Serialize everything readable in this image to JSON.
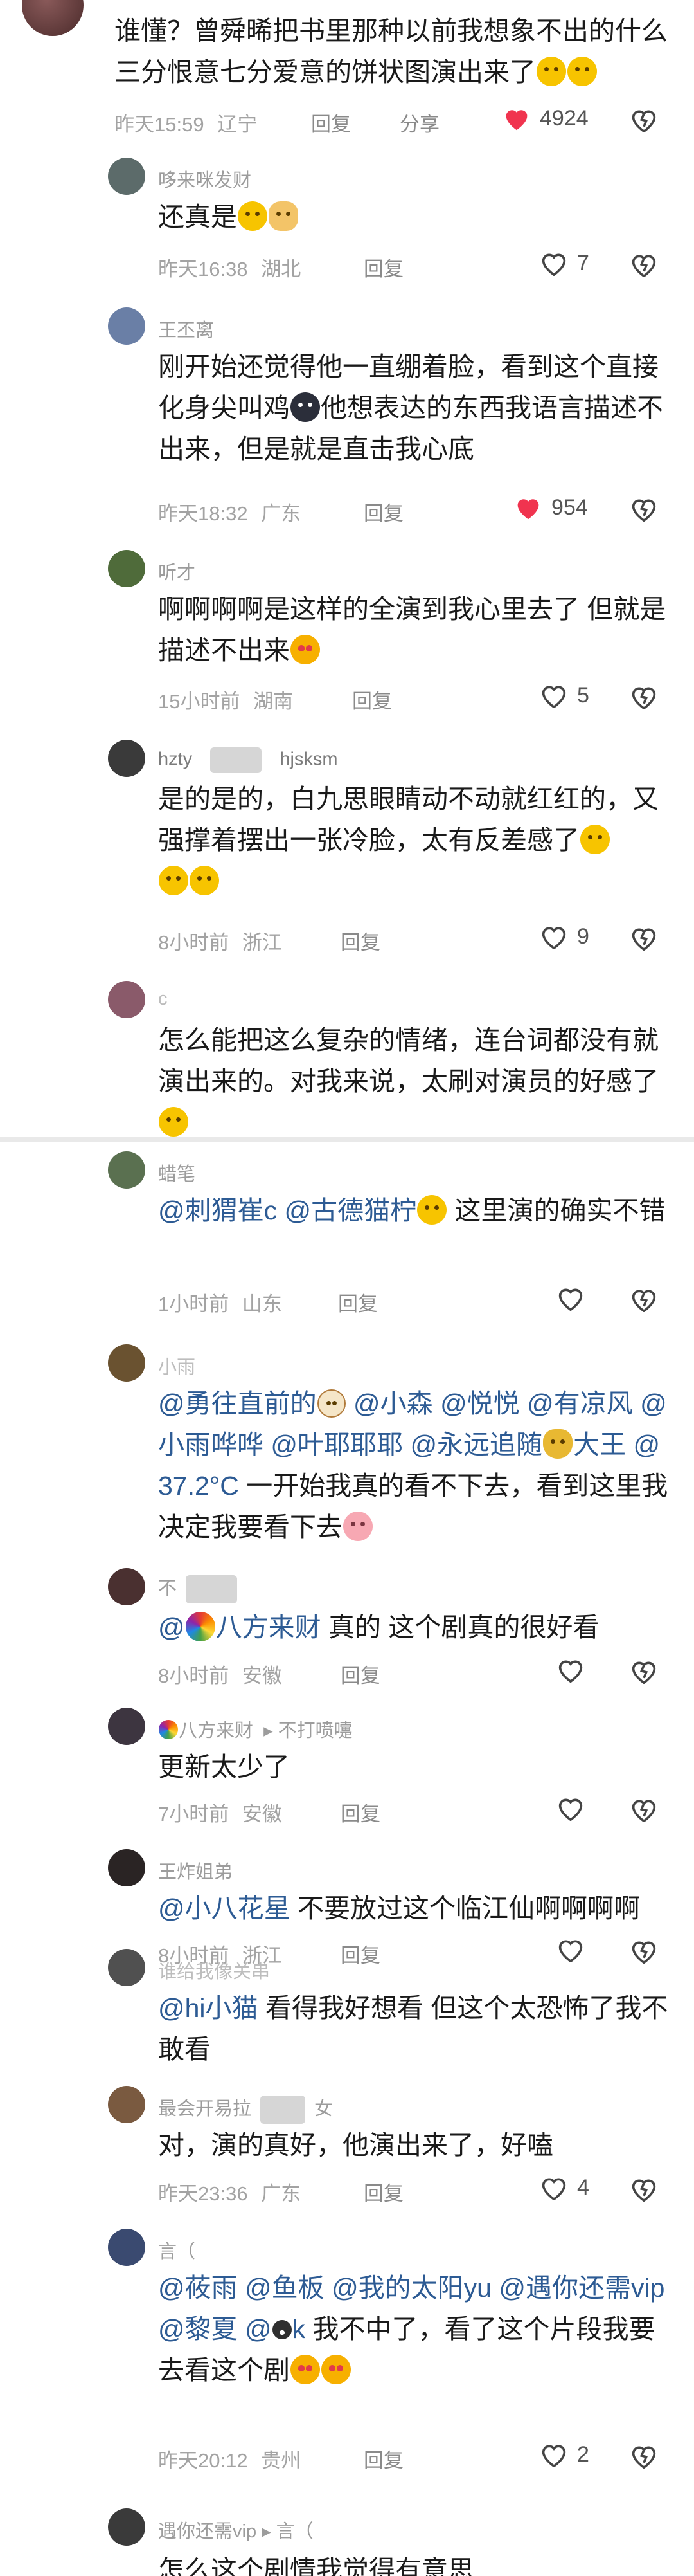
{
  "comments": [
    {
      "text_parts": [
        "谁懂？曾舜晞把书里那种以前我想象不出的什么三分恨意七分爱意的饼状图演出来了"
      ],
      "time": "昨天15:59",
      "location": "辽宁",
      "reply": "回复",
      "share": "分享",
      "likes": "4924"
    },
    {
      "username": "哆来咪发财",
      "text": "还真是",
      "time": "昨天16:38",
      "location": "湖北",
      "reply": "回复",
      "likes": "7"
    },
    {
      "username": "王丕离",
      "text_a": "刚开始还觉得他一直绷着脸，看到这个直接化身尖叫鸡",
      "text_b": "他想表达的东西我语言描述不出来，但是就是直击我心底",
      "time": "昨天18:32",
      "location": "广东",
      "reply": "回复",
      "likes": "954"
    },
    {
      "username": "听才",
      "text": "啊啊啊啊是这样的全演到我心里去了 但就是描述不出来",
      "time": "15小时前",
      "location": "湖南",
      "reply": "回复",
      "likes": "5"
    },
    {
      "username_a": "hzty",
      "username_b": "hjsksm",
      "text": "是的是的，白九思眼睛动不动就红红的，又强撑着摆出一张冷脸，太有反差感了",
      "time": "8小时前",
      "location": "浙江",
      "reply": "回复",
      "likes": "9"
    },
    {
      "username": "c",
      "text": "怎么能把这么复杂的情绪，连台词都没有就演出来的。对我来说，太刷对演员的好感了"
    },
    {
      "username": "蜡笔",
      "mention1": "@刺猬崔c",
      "mention2": "@古德猫柠",
      "text": " 这里演的确实不错",
      "time": "1小时前",
      "location": "山东",
      "reply": "回复"
    },
    {
      "username": "小雨",
      "m1": "@勇往直前的",
      "m2": "@小森",
      "m3": "@悦悦",
      "m4": "@有凉风",
      "m5": "@小雨哗哗",
      "m6": "@叶耶耶耶",
      "m7": "@永远追随",
      "m7b": "大王",
      "m8": "@37.2°C",
      "text": " 一开始我真的看不下去，看到这里我决定我要看下去"
    },
    {
      "username": "不",
      "mention": "八方来财",
      "text": " 真的 这个剧真的很好看",
      "time": "8小时前",
      "location": "安徽",
      "reply": "回复"
    },
    {
      "username": "八方来财",
      "tag": "不打喷嚏",
      "text": "更新太少了",
      "time": "7小时前",
      "location": "安徽",
      "reply": "回复"
    },
    {
      "username": "王炸姐弟",
      "mention": "@小八花星",
      "text": " 不要放过这个临江仙啊啊啊啊",
      "time": "8小时前",
      "location": "浙江",
      "reply": "回复"
    },
    {
      "username": "谁给我像关串",
      "mention": "@hi小猫",
      "text": " 看得我好想看 但这个太恐怖了我不敢看"
    },
    {
      "username": "最会开易拉",
      "tag": "女",
      "text": "对，演的真好，他演出来了，好嗑",
      "time": "昨天23:36",
      "location": "广东",
      "reply": "回复",
      "likes": "4"
    },
    {
      "username": "言（",
      "m1": "@莜雨",
      "m2": "@鱼板",
      "m3": "@我的太阳yu",
      "m4": "@遇你还需vip",
      "m5": "@黎夏",
      "m6": "@",
      "m6b": "k",
      "text": " 我不中了，看了这个片段我要去看这个剧",
      "time": "昨天20:12",
      "location": "贵州",
      "reply": "回复",
      "likes": "2"
    },
    {
      "username": "遇你还需vip",
      "tag": "言（",
      "text": "怎么这个剧情我觉得有意思"
    }
  ],
  "colors": {
    "like_red": "#f0344f",
    "mention_blue": "#2d5b94",
    "meta_gray": "#a3a3a3"
  }
}
